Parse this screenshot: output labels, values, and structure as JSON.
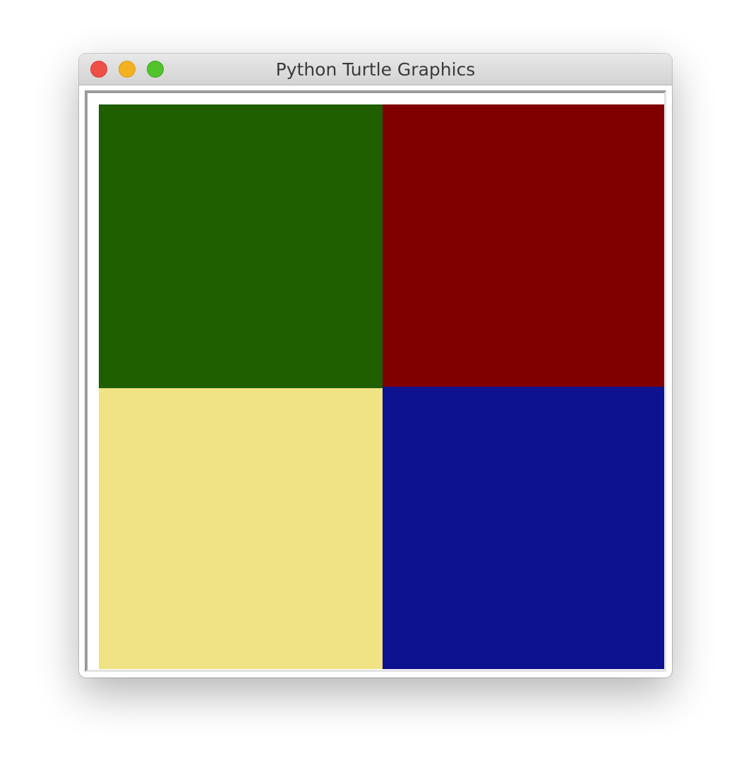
{
  "window": {
    "title": "Python Turtle Graphics"
  },
  "traffic_lights": {
    "close_color": "#ee4f47",
    "minimize_color": "#f5b021",
    "zoom_color": "#52c42b"
  },
  "canvas": {
    "background": "#ffffff",
    "quadrants": [
      {
        "name": "top-left",
        "color": "#1f5f00"
      },
      {
        "name": "top-right",
        "color": "#800000"
      },
      {
        "name": "bottom-left",
        "color": "#f0e384"
      },
      {
        "name": "bottom-right",
        "color": "#0d1290"
      }
    ]
  }
}
